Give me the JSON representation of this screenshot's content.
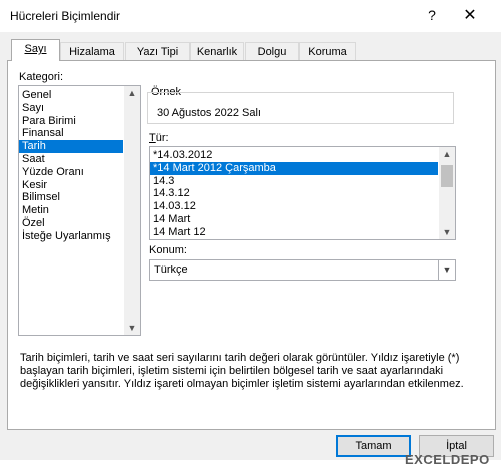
{
  "window": {
    "title": "Hücreleri Biçimlendir",
    "help": "?",
    "close": "✕"
  },
  "tabs": [
    "Sayı",
    "Hizalama",
    "Yazı Tipi",
    "Kenarlık",
    "Dolgu",
    "Koruma"
  ],
  "category": {
    "label": "Kategori:",
    "items": [
      "Genel",
      "Sayı",
      "Para Birimi",
      "Finansal",
      "Tarih",
      "Saat",
      "Yüzde Oranı",
      "Kesir",
      "Bilimsel",
      "Metin",
      "Özel",
      "İsteğe Uyarlanmış"
    ],
    "selected_index": 4
  },
  "sample": {
    "label": "Örnek",
    "value": "30 Ağustos 2022 Salı"
  },
  "type": {
    "label": "Tür:",
    "items": [
      "*14.03.2012",
      "*14 Mart 2012 Çarşamba",
      "14.3",
      "14.3.12",
      "14.03.12",
      "14 Mart",
      "14 Mart 12"
    ],
    "selected_index": 1
  },
  "locale": {
    "label": "Konum:",
    "value": "Türkçe"
  },
  "description": "Tarih biçimleri, tarih ve saat seri sayılarını tarih değeri olarak görüntüler. Yıldız işaretiyle (*) başlayan tarih biçimleri, işletim sistemi için belirtilen bölgesel tarih ve saat ayarlarındaki değişiklikleri yansıtır. Yıldız işareti olmayan biçimler işletim sistemi ayarlarından etkilenmez.",
  "buttons": {
    "ok": "Tamam",
    "cancel": "İptal"
  },
  "watermark": "EXCELDEPO"
}
